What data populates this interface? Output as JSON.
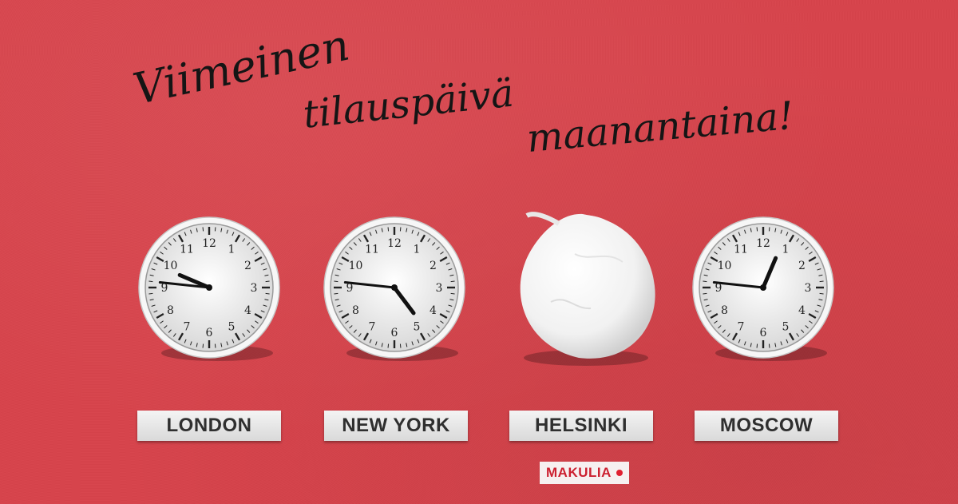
{
  "headline": {
    "line1": "Viimeinen",
    "line2": "tilauspäivä",
    "line3": "maanantaina!"
  },
  "clocks": [
    {
      "city": "LONDON",
      "hour": 9,
      "minute": 46
    },
    {
      "city": "NEW YORK",
      "hour": 4,
      "minute": 46
    },
    {
      "city": "HELSINKI",
      "replaced_by": "mozzarella-ball"
    },
    {
      "city": "MOSCOW",
      "hour": 12,
      "minute": 46
    }
  ],
  "dial_numbers": [
    "12",
    "1",
    "2",
    "3",
    "4",
    "5",
    "6",
    "7",
    "8",
    "9",
    "10",
    "11"
  ],
  "brand": {
    "name": "MAKULIA"
  },
  "colors": {
    "background": "#d7434b",
    "brand_red": "#cc2030",
    "label_text": "#2f2f2f"
  }
}
